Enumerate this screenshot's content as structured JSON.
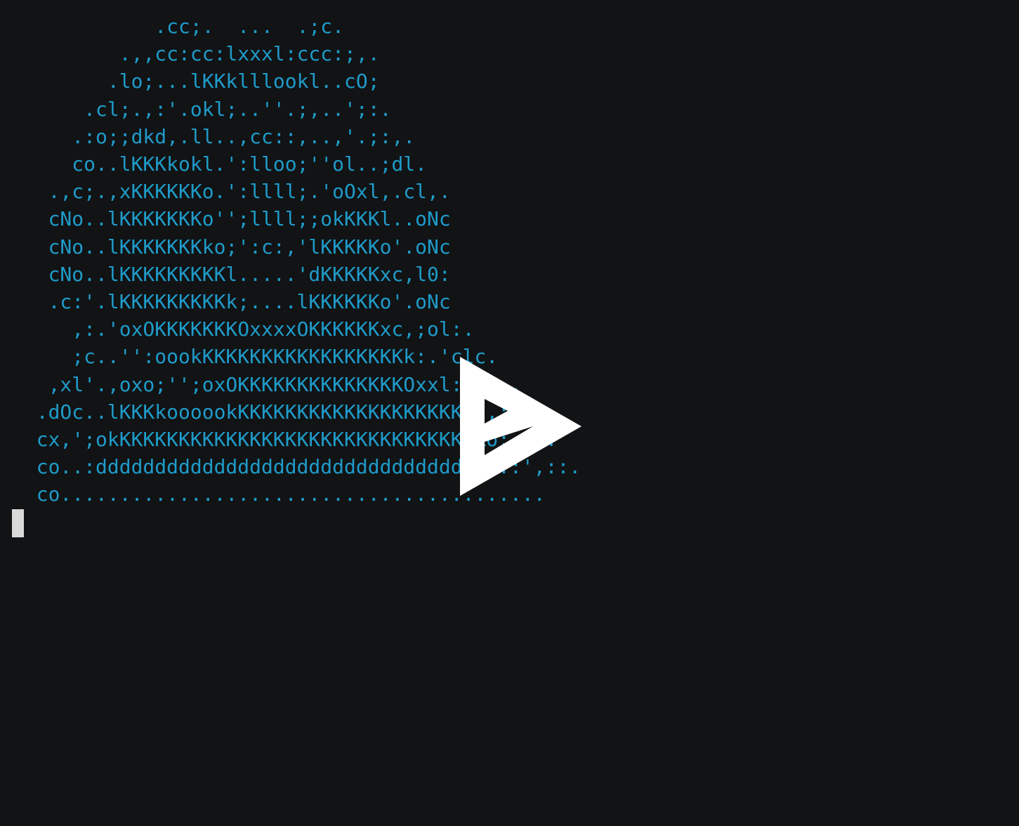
{
  "terminal": {
    "background_color": "#111315",
    "text_color": "#1f9bc9",
    "cursor_color": "#d9d9d9",
    "lines": [
      "            .cc;.  ...  .;c.",
      "         .,,cc:cc:lxxxl:ccc:;,.",
      "        .lo;...lKKklllookl..cO;",
      "      .cl;.,:'.okl;..''.;,..';:.",
      "     .:o;;dkd,.ll..,cc::,..,'.;:,.",
      "     co..lKKKkokl.':lloo;''ol..;dl.",
      "   .,c;.,xKKKKKKo.':llll;.'oOxl,.cl,.",
      "   cNo..lKKKKKKKo'';llll;;okKKKl..oNc",
      "   cNo..lKKKKKKKko;':c:,'lKKKKKo'.oNc",
      "   cNo..lKKKKKKKKKl.....'dKKKKKxc,l0:",
      "   .c:'.lKKKKKKKKKk;....lKKKKKKo'.oNc",
      "     ,:.'oxOKKKKKKKOxxxxOKKKKKKxc,;ol:.",
      "     ;c..'':oookKKKKKKKKKKKKKKKKKk:.'clc.",
      "   ,xl'.,oxo;'';oxOKKKKKKKKKKKKKKOxxl:::;,.",
      "  .dOc..lKKKkoooookKKKKKKKKKKKKKKKKKKKd;,::.",
      "  cx,';okKKKKKKKKKKKKKKKKKKKKKKKKKKKKKKKo;,:c.",
      "  co..:dddddddddddddddddddddddddddddddddl::',::.",
      "  co........................................."
    ]
  },
  "player": {
    "play_icon_color": "#ffffff"
  }
}
